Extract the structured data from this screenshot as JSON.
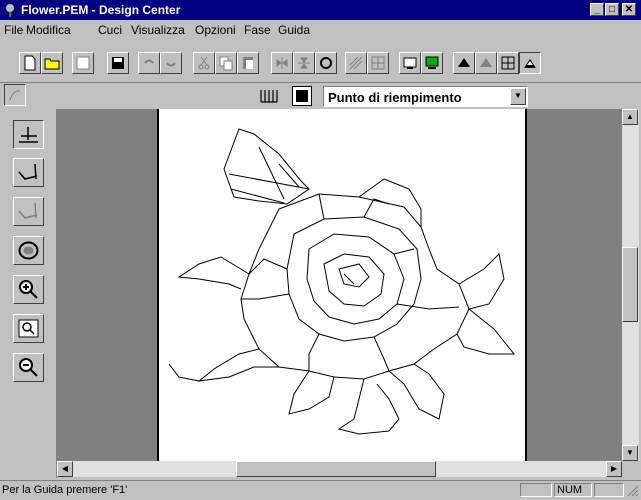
{
  "window": {
    "title": "Flower.PEM - Design Center"
  },
  "menu": [
    "File",
    "Modifica",
    "Cuci",
    "Visualizza",
    "Opzioni",
    "Fase",
    "Guida"
  ],
  "toolbar": {
    "icons": [
      "new-icon",
      "open-icon",
      "import-icon",
      "save-icon",
      "undo-icon",
      "redo-icon",
      "cut-icon",
      "copy-icon",
      "paste-icon",
      "flip-icon",
      "mirror-icon",
      "rotate-icon",
      "stitch-pattern-icon",
      "fill-pattern-icon",
      "preview-icon",
      "monitor-icon",
      "sew-icon",
      "zoom-sew-icon",
      "grid-icon",
      "mask-icon"
    ]
  },
  "secondary": {
    "stitch_type": "Punto di riempimento"
  },
  "left_tools": [
    "line-tool-icon",
    "curve-tool-icon",
    "curve-alt-tool-icon",
    "region-tool-icon",
    "zoom-in-icon",
    "zoom-fit-icon",
    "zoom-out-icon"
  ],
  "status": {
    "help": "Per la Guida premere 'F1'",
    "num": "NUM"
  }
}
